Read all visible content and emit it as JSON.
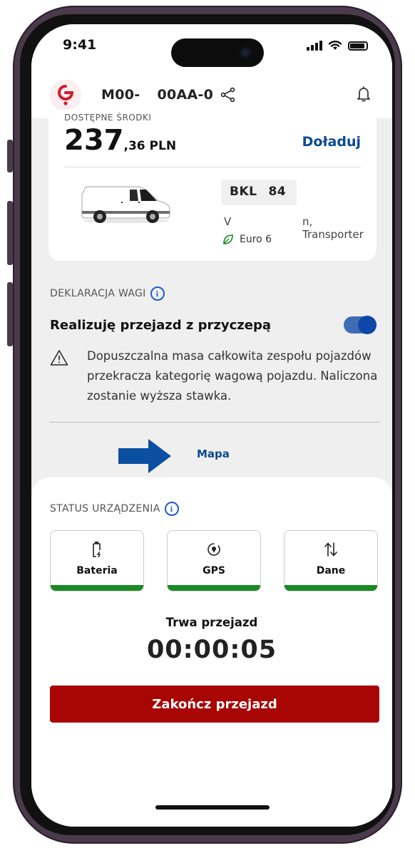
{
  "status_bar": {
    "time": "9:41"
  },
  "header": {
    "plate_part1": "M00-",
    "plate_part2": "00AA-0"
  },
  "funds": {
    "label": "DOSTĘPNE ŚRODKI",
    "amount_main": "237",
    "amount_fraction": ",36 PLN",
    "topup_label": "Doładuj"
  },
  "vehicle": {
    "plate_a": "BKL",
    "plate_b": "84",
    "model_a": "V",
    "model_b": "n, Transporter",
    "emission": "Euro 6"
  },
  "declaration": {
    "label": "DEKLARACJA WAGI",
    "trailer_label": "Realizuję przejazd z przyczepą",
    "trailer_enabled": true,
    "warning": "Dopuszczalna masa całkowita zespołu pojazdów przekracza kategorię wagową pojazdu. Naliczona zostanie wyższa stawka."
  },
  "map_link": "Mapa",
  "device_status": {
    "label": "STATUS URZĄDZENIA",
    "tiles": [
      {
        "label": "Bateria",
        "icon": "battery-charging-icon",
        "status_color": "#1a8a22"
      },
      {
        "label": "GPS",
        "icon": "location-target-icon",
        "status_color": "#1a8a22"
      },
      {
        "label": "Dane",
        "icon": "data-transfer-icon",
        "status_color": "#1a8a22"
      }
    ]
  },
  "trip": {
    "label": "Trwa przejazd",
    "elapsed": "00:00:05",
    "end_button": "Zakończ przejazd"
  },
  "colors": {
    "accent_blue": "#0b4a93",
    "danger_red": "#a80505",
    "ok_green": "#1a8a22"
  }
}
